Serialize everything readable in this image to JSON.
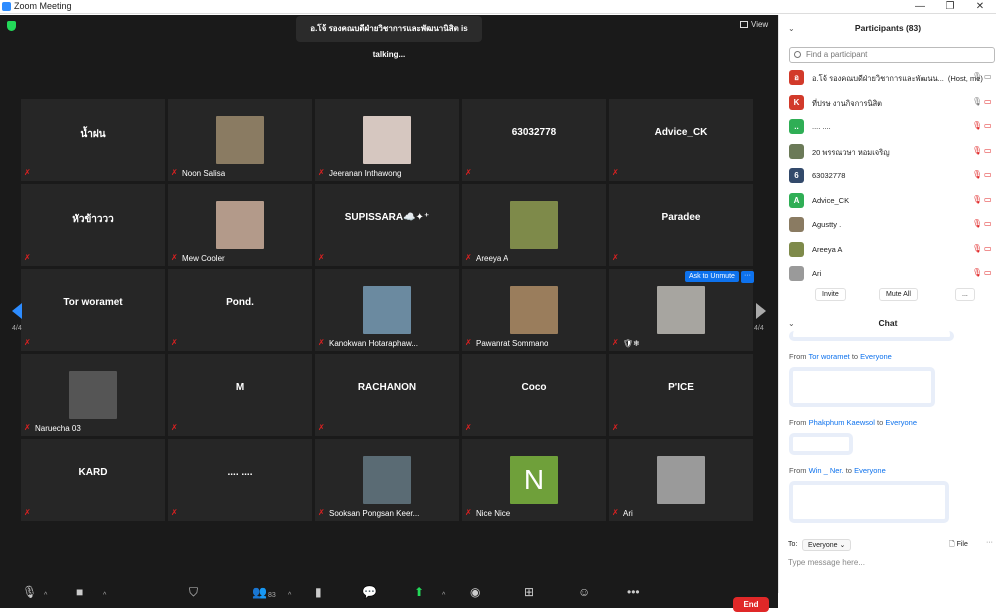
{
  "window": {
    "title": "Zoom Meeting",
    "minimize": "—",
    "maximize": "❐",
    "close": "✕"
  },
  "meeting": {
    "talking": "อ.โจ้ รองคณบดีฝ่ายวิชาการและพัฒนานิสิต is talking...",
    "view_label": "View",
    "page_left": "4/4",
    "page_right": "4/4",
    "ask_to_unmute": "Ask to Unmute",
    "more": "···"
  },
  "tiles": [
    {
      "name": "น้ำฝน",
      "label": ""
    },
    {
      "name": "",
      "label": "Noon Salisa",
      "photo": true,
      "photo_color": "#8a7b62"
    },
    {
      "name": "",
      "label": "Jeeranan Inthawong",
      "photo": true,
      "photo_color": "#d6c7c0"
    },
    {
      "name": "63032778",
      "label": ""
    },
    {
      "name": "Advice_CK",
      "label": ""
    },
    {
      "name": "หัวข้าววว",
      "label": ""
    },
    {
      "name": "",
      "label": "Mew Cooler",
      "photo": true,
      "photo_color": "#b39a8a"
    },
    {
      "name": "SUPISSARA☁️✦⁺",
      "label": ""
    },
    {
      "name": "",
      "label": "Areeya A",
      "photo": true,
      "photo_color": "#7e8a4a"
    },
    {
      "name": "Paradee",
      "label": ""
    },
    {
      "name": "Tor woramet",
      "label": ""
    },
    {
      "name": "Pond.",
      "label": ""
    },
    {
      "name": "",
      "label": "Kanokwan Hotaraphaw...",
      "photo": true,
      "photo_color": "#6b8aa0"
    },
    {
      "name": "",
      "label": "Pawanrat Sommano",
      "photo": true,
      "photo_color": "#9a7d5c"
    },
    {
      "name": "",
      "label": "🛡❄",
      "photo": true,
      "photo_color": "#a7a5a0"
    },
    {
      "name": "",
      "label": "Naruecha 03",
      "photo": true,
      "photo_color": "#555555"
    },
    {
      "name": "M",
      "label": ""
    },
    {
      "name": "RACHANON",
      "label": ""
    },
    {
      "name": "Coco",
      "label": ""
    },
    {
      "name": "P'ICE",
      "label": ""
    },
    {
      "name": "KARD",
      "label": ""
    },
    {
      "name": ".... ....",
      "label": ""
    },
    {
      "name": "",
      "label": "Sooksan Pongsan Keer...",
      "photo": true,
      "photo_color": "#5a6b74"
    },
    {
      "name": "",
      "label": "Nice Nice",
      "photo": true,
      "photo_color": "#6fa03a",
      "letter": "N"
    },
    {
      "name": "",
      "label": "Ari",
      "photo": true,
      "photo_color": "#9a9a9a"
    }
  ],
  "toolbar": {
    "participant_count": "83",
    "end_label": "End"
  },
  "participants": {
    "header": "Participants (83)",
    "search_placeholder": "Find a participant",
    "list": [
      {
        "initial": "อ",
        "color": "#d23a2a",
        "name": "อ.โจ้ รองคณบดีฝ่ายวิชาการและพัฒนน...",
        "role": "(Host, me)"
      },
      {
        "initial": "K",
        "color": "#d23a2a",
        "name": "ที่ปรษ งานกิจการนิสิต"
      },
      {
        "initial": "..",
        "color": "#2fae55",
        "name": ".... ...."
      },
      {
        "initial": "",
        "color": "#6b7a58",
        "name": "20 พรรณวษา หอมเจริญ"
      },
      {
        "initial": "6",
        "color": "#334a6b",
        "name": "63032778"
      },
      {
        "initial": "A",
        "color": "#2fae55",
        "name": "Advice_CK"
      },
      {
        "initial": "",
        "color": "#8a7b62",
        "name": "Agustty ."
      },
      {
        "initial": "",
        "color": "#7e8a4a",
        "name": "Areeya A"
      },
      {
        "initial": "",
        "color": "#9a9a9a",
        "name": "Ari"
      }
    ],
    "invite": "Invite",
    "mute_all": "Mute All",
    "more": "..."
  },
  "chat": {
    "header": "Chat",
    "messages": [
      {
        "from": "Tor woramet",
        "to": "Everyone"
      },
      {
        "from": "Phakphum Kaewsol",
        "to": "Everyone"
      },
      {
        "from": "Win _ Ner.",
        "to": "Everyone"
      }
    ],
    "from_word": "From",
    "to_word": "to",
    "to_label": "To:",
    "recipient": "Everyone",
    "file": "File",
    "placeholder": "Type message here..."
  }
}
